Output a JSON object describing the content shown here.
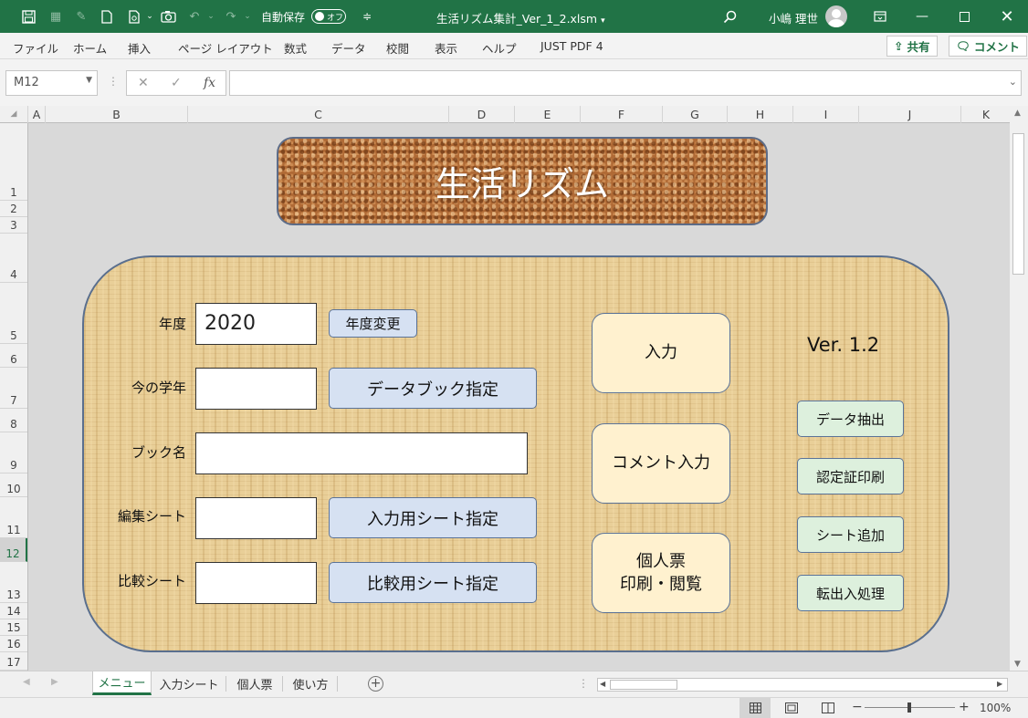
{
  "window": {
    "autosave_label": "自動保存",
    "autosave_state": "オフ",
    "filename": "生活リズム集計_Ver_1_2.xlsm",
    "user_name": "小嶋 理世"
  },
  "ribbon": {
    "tabs": [
      "ファイル",
      "ホーム",
      "挿入",
      "ページ レイアウト",
      "数式",
      "データ",
      "校閲",
      "表示",
      "ヘルプ",
      "JUST PDF 4"
    ],
    "share_label": "共有",
    "comment_label": "コメント"
  },
  "formula_bar": {
    "name_box": "M12",
    "fx_label": "fx",
    "content": ""
  },
  "columns": [
    "A",
    "B",
    "C",
    "D",
    "E",
    "F",
    "G",
    "H",
    "I",
    "J",
    "K"
  ],
  "rows": [
    "1",
    "2",
    "3",
    "4",
    "5",
    "6",
    "7",
    "8",
    "9",
    "10",
    "11",
    "12",
    "13",
    "14",
    "15",
    "16",
    "17"
  ],
  "selected_row": "12",
  "menu": {
    "title": "生活リズム",
    "version": "Ver. 1.2",
    "fields": {
      "year_label": "年度",
      "year_value": "2020",
      "grade_label": "今の学年",
      "grade_value": "",
      "book_label": "ブック名",
      "book_value": "",
      "edit_sheet_label": "編集シート",
      "edit_sheet_value": "",
      "compare_sheet_label": "比較シート",
      "compare_sheet_value": ""
    },
    "buttons": {
      "year_change": "年度変更",
      "databook": "データブック指定",
      "input_sheet": "入力用シート指定",
      "compare_sheet": "比較用シート指定",
      "input": "入力",
      "comment_input": "コメント入力",
      "personal_line1": "個人票",
      "personal_line2": "印刷・閲覧",
      "data_extract": "データ抽出",
      "cert_print": "認定証印刷",
      "add_sheet": "シート追加",
      "transfer": "転出入処理"
    }
  },
  "sheet_tabs": [
    "メニュー",
    "入力シート",
    "個人票",
    "使い方"
  ],
  "active_sheet": "メニュー",
  "status": {
    "zoom": "100%"
  },
  "colors": {
    "excel_green": "#217346",
    "cork": "#b06a35",
    "parchment": "#e9cf98",
    "blue_button": "#d6e1f2",
    "yellow_button": "#fff1cf",
    "green_button": "#ddf0dd"
  }
}
